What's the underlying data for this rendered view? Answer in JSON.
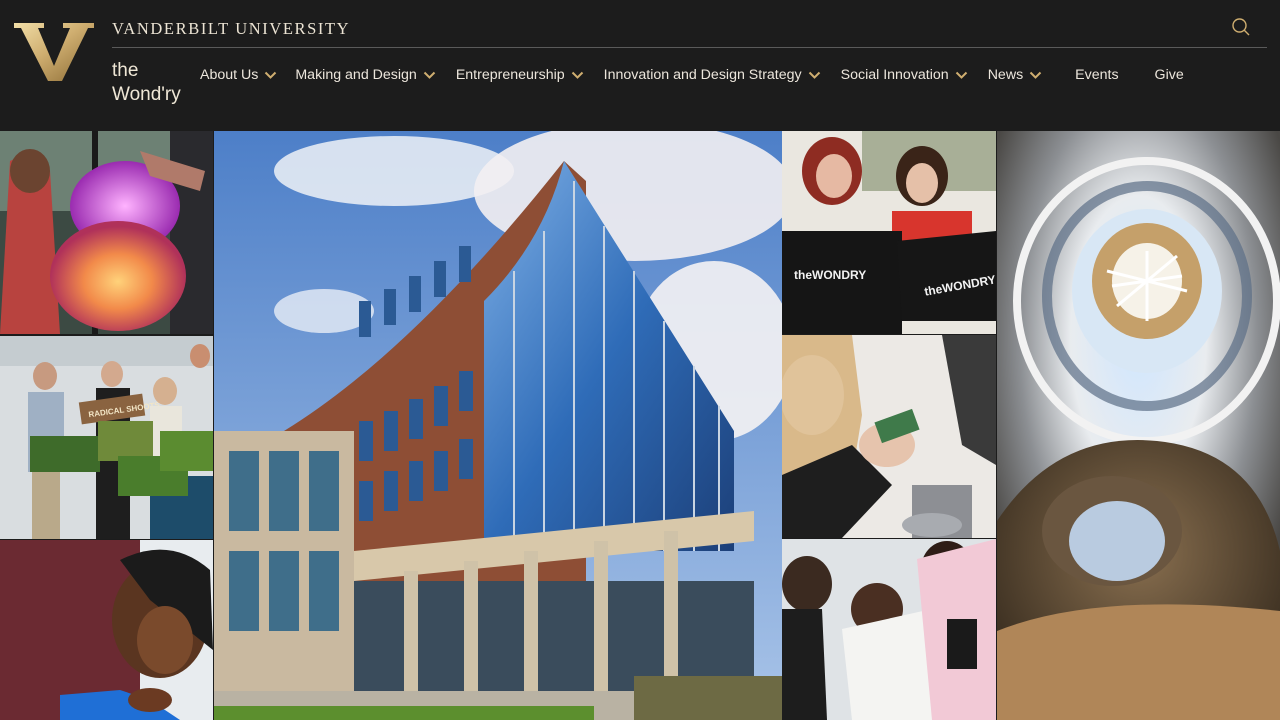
{
  "header": {
    "university_name": "VANDERBILT UNIVERSITY",
    "site_name_line1": "the",
    "site_name_line2": "Wond'ry",
    "logo_icon": "vanderbilt-v-logo",
    "search_icon": "search-icon"
  },
  "nav": {
    "items": [
      {
        "label": "About Us",
        "has_dropdown": true
      },
      {
        "label": "Making and Design",
        "has_dropdown": true
      },
      {
        "label": "Entrepreneurship",
        "has_dropdown": true
      },
      {
        "label": "Innovation and Design Strategy",
        "has_dropdown": true
      },
      {
        "label": "Social Innovation",
        "has_dropdown": true
      },
      {
        "label": "News",
        "has_dropdown": true
      },
      {
        "label": "Events",
        "has_dropdown": false
      },
      {
        "label": "Give",
        "has_dropdown": false
      }
    ]
  },
  "collage": {
    "shirt_text_left": "theWONDRY",
    "shirt_text_right": "theWONDRY",
    "sign_text": "RADICAL SHOOTS"
  },
  "colors": {
    "header_bg": "#1c1c1c",
    "gold": "#cfae70",
    "nav_text": "#ece6dc",
    "chevron": "#cfae70"
  }
}
